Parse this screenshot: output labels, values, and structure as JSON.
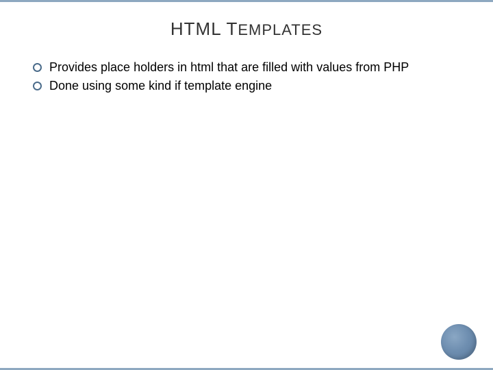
{
  "slide": {
    "title_first": "HTML T",
    "title_rest": "emplates",
    "bullets": [
      "Provides place holders in html that are filled with values from PHP",
      "Done using some kind if template engine"
    ]
  }
}
